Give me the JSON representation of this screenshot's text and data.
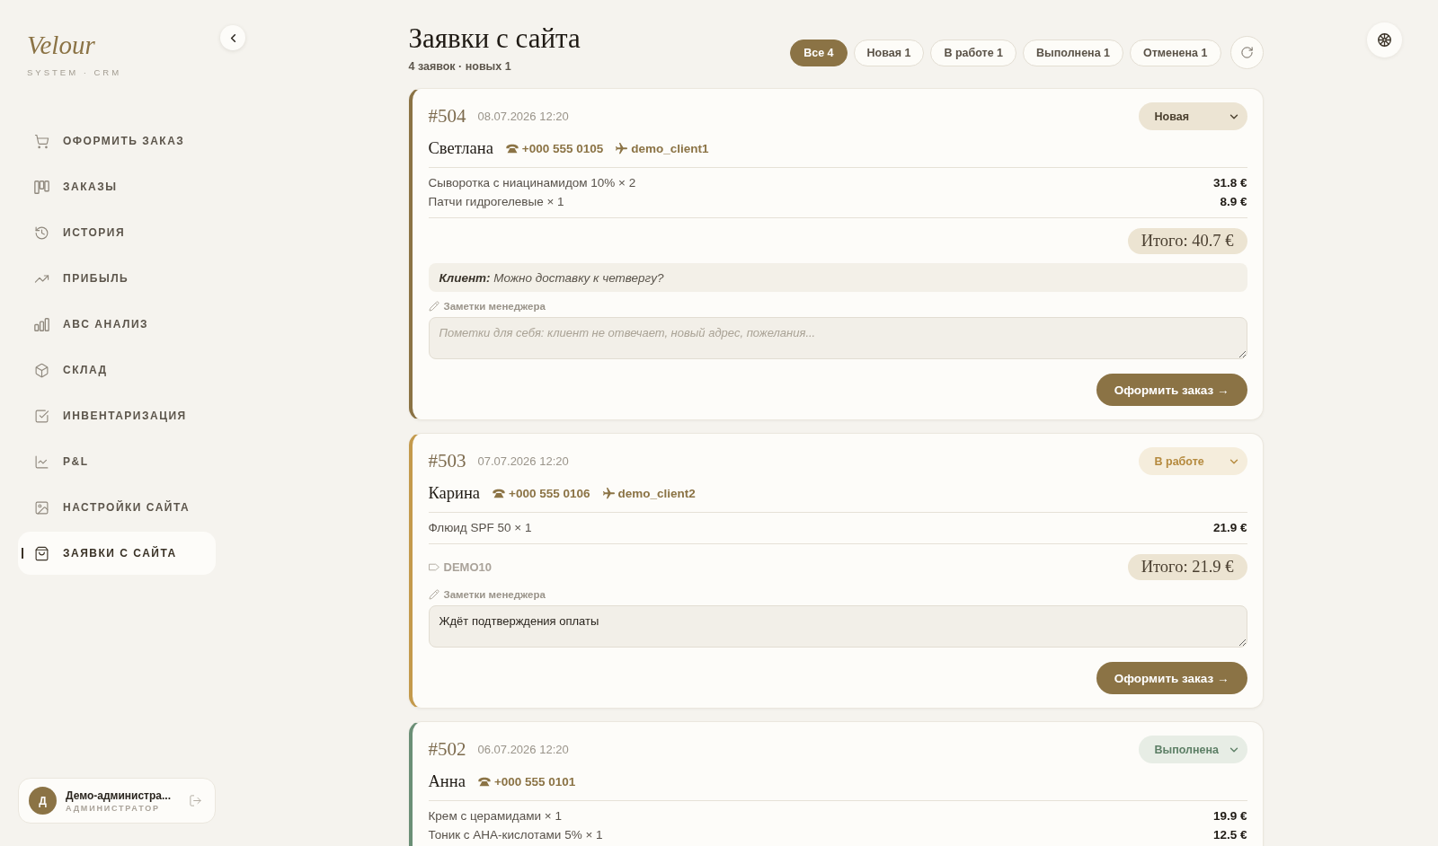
{
  "sidebar": {
    "logo": "Velour",
    "tagline": "SYSTEM · CRM",
    "items": [
      {
        "label": "ОФОРМИТЬ ЗАКАЗ",
        "selected": false
      },
      {
        "label": "ЗАКАЗЫ",
        "selected": false
      },
      {
        "label": "ИСТОРИЯ",
        "selected": false
      },
      {
        "label": "ПРИБЫЛЬ",
        "selected": false
      },
      {
        "label": "ABC АНАЛИЗ",
        "selected": false
      },
      {
        "label": "СКЛАД",
        "selected": false
      },
      {
        "label": "ИНВЕНТАРИЗАЦИЯ",
        "selected": false
      },
      {
        "label": "P&L",
        "selected": false
      },
      {
        "label": "НАСТРОЙКИ САЙТА",
        "selected": false
      },
      {
        "label": "ЗАЯВКИ С САЙТА",
        "selected": true
      }
    ],
    "user": {
      "initial": "Д",
      "name": "Демо-администра...",
      "role": "АДМИНИСТРАТОР"
    }
  },
  "header": {
    "title": "Заявки с сайта",
    "subtitle": "4 заявок · новых 1",
    "filters": [
      {
        "label": "Все 4",
        "selected": true
      },
      {
        "label": "Новая 1",
        "selected": false
      },
      {
        "label": "В работе 1",
        "selected": false
      },
      {
        "label": "Выполнена 1",
        "selected": false
      },
      {
        "label": "Отменена 1",
        "selected": false
      }
    ]
  },
  "orders": [
    {
      "number": "#504",
      "date": "08.07.2026 12:20",
      "status": {
        "value": "Новая",
        "kind": "new"
      },
      "customer": "Светлана",
      "phone": "+000 555 0105",
      "username": "demo_client1",
      "items": [
        {
          "name": "Сыворотка с ниацинамидом 10% × 2",
          "price": "31.8 €"
        },
        {
          "name": "Патчи гидрогелевые × 1",
          "price": "8.9 €"
        }
      ],
      "total": "Итого: 40.7 €",
      "comment": "**Клиент:** Можно доставку к четвергу?",
      "notes_label": "Заметки менеджера",
      "notes": {
        "placeholder": "Пометки для себя: клиент не отвечает, новый адрес, пожелания..."
      },
      "action": "Оформить заказ →"
    },
    {
      "number": "#503",
      "date": "07.07.2026 12:20",
      "status": {
        "value": "В работе",
        "kind": "progress"
      },
      "customer": "Карина",
      "phone": "+000 555 0106",
      "username": "demo_client2",
      "items": [
        {
          "name": "Флюид SPF 50 × 1",
          "price": "21.9 €"
        }
      ],
      "promo": "DEMO10",
      "total": "Итого: 21.9 €",
      "notes_label": "Заметки менеджера",
      "notes": {
        "value": "Ждёт подтверждения оплаты"
      },
      "action": "Оформить заказ →"
    },
    {
      "number": "#502",
      "date": "06.07.2026 12:20",
      "status": {
        "value": "Выполнена",
        "kind": "done"
      },
      "customer": "Анна",
      "phone": "+000 555 0101",
      "items": [
        {
          "name": "Крем с церамидами × 1",
          "price": "19.9 €"
        },
        {
          "name": "Тоник с AHA-кислотами 5% × 1",
          "price": "12.5 €"
        }
      ]
    }
  ]
}
